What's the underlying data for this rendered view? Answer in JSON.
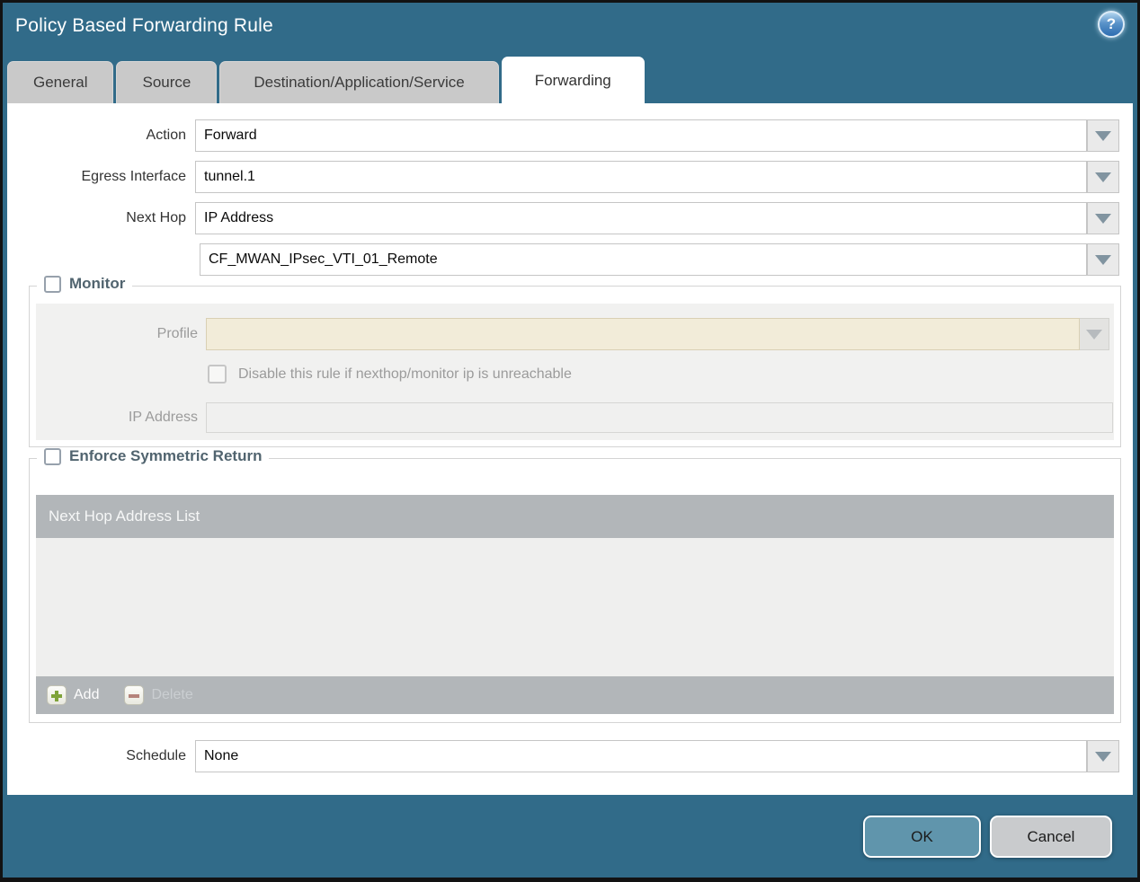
{
  "dialog": {
    "title": "Policy Based Forwarding Rule"
  },
  "icons": {
    "help": "?"
  },
  "tabs": [
    {
      "label": "General",
      "active": false
    },
    {
      "label": "Source",
      "active": false
    },
    {
      "label": "Destination/Application/Service",
      "active": false
    },
    {
      "label": "Forwarding",
      "active": true
    }
  ],
  "form": {
    "action": {
      "label": "Action",
      "value": "Forward"
    },
    "egress_interface": {
      "label": "Egress Interface",
      "value": "tunnel.1"
    },
    "next_hop": {
      "label": "Next Hop",
      "value": "IP Address"
    },
    "next_hop_address": {
      "value": "CF_MWAN_IPsec_VTI_01_Remote"
    },
    "schedule": {
      "label": "Schedule",
      "value": "None"
    }
  },
  "monitor": {
    "legend": "Monitor",
    "checked": false,
    "profile": {
      "label": "Profile",
      "value": ""
    },
    "disable_rule": {
      "label": "Disable this rule if nexthop/monitor ip is unreachable",
      "checked": false
    },
    "ip_address": {
      "label": "IP Address",
      "value": ""
    }
  },
  "symmetric_return": {
    "legend": "Enforce Symmetric Return",
    "checked": false,
    "table": {
      "header": "Next Hop Address List",
      "rows": []
    },
    "add_label": "Add",
    "delete_label": "Delete"
  },
  "footer": {
    "ok_label": "OK",
    "cancel_label": "Cancel"
  },
  "colors": {
    "titlebar_teal": "#316b89",
    "tab_inactive": "#c9c9c9",
    "tab_active": "#ffffff",
    "legend_text": "#51646f",
    "disabled_field_beige": "#f2ecd9",
    "table_bar_grey": "#b2b6b9",
    "ok_button": "#6095ac",
    "cancel_button": "#c9cbcd",
    "add_plus_green": "#7fa33a",
    "delete_minus_red": "#b5837a"
  }
}
